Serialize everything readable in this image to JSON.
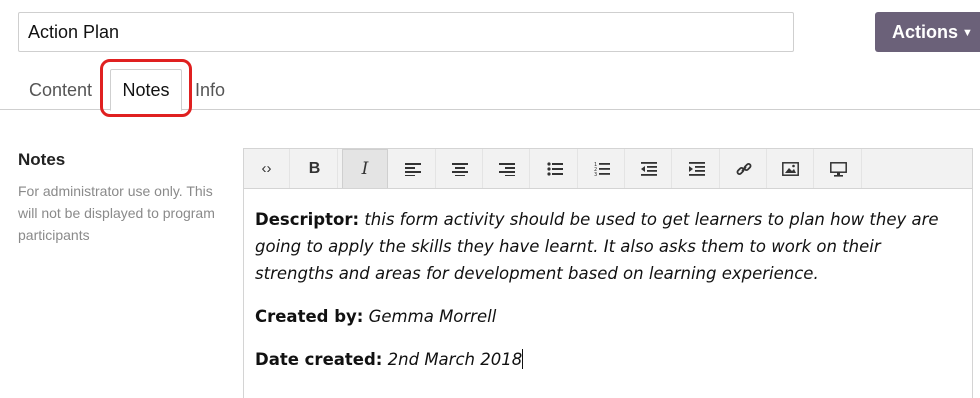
{
  "header": {
    "title_value": "Action Plan",
    "actions_label": "Actions"
  },
  "tabs": [
    {
      "label": "Content"
    },
    {
      "label": "Notes"
    },
    {
      "label": "Info"
    }
  ],
  "sidebar": {
    "title": "Notes",
    "help": "For administrator use only. This will not be displayed to program participants"
  },
  "toolbar": {
    "buttons": [
      "code-view",
      "bold",
      "italic",
      "align-left",
      "align-center",
      "align-right",
      "bullet-list",
      "numbered-list",
      "outdent",
      "indent",
      "link",
      "image",
      "media"
    ]
  },
  "editor": {
    "descriptor_label": "Descriptor:",
    "descriptor_text": "this form activity should be used to get learners to plan how they are going to apply the skills they have learnt. It also asks them to work on their strengths and areas for development based on learning experience.",
    "created_by_label": "Created by:",
    "created_by_value": "Gemma Morrell",
    "date_label": "Date created:",
    "date_value": "2nd March 2018"
  },
  "colors": {
    "accent": "#6b6179",
    "highlight_ring": "#e02020"
  }
}
